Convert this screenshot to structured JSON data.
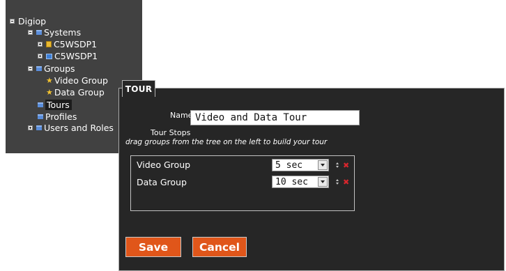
{
  "tree": {
    "root": "Digiop",
    "systems": "Systems",
    "system_1": "C5WSDP1",
    "system_2": "C5WSDP1",
    "groups": "Groups",
    "group_video": "Video Group",
    "group_data": "Data Group",
    "tours": "Tours",
    "profiles": "Profiles",
    "users_roles": "Users and Roles"
  },
  "dialog": {
    "tab_title": "TOUR",
    "name_label": "Name",
    "name_value": "Video and Data Tour",
    "stops_label": "Tour Stops",
    "stops_hint": "drag groups from the tree on the left to build your tour",
    "stops": [
      {
        "name": "Video Group",
        "duration": "5 sec"
      },
      {
        "name": "Data Group",
        "duration": "10 sec"
      }
    ],
    "remove_glyph": "✖",
    "save_label": "Save",
    "cancel_label": "Cancel"
  },
  "colors": {
    "panel_bg": "#414141",
    "dialog_bg": "#262626",
    "button_orange": "#e0561a",
    "remove_red": "#d6262d",
    "folder_blue": "#5b8edb",
    "star_gold": "#f2c230"
  },
  "icons": [
    "collapse-icon",
    "expand-icon",
    "folder-icon",
    "system-icon",
    "star-icon",
    "sort-handle-icon",
    "remove-icon",
    "dropdown-arrow-icon"
  ]
}
